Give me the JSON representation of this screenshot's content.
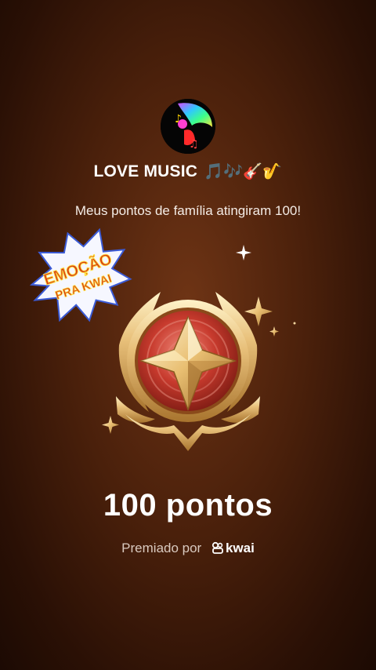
{
  "channel": {
    "name": "LOVE MUSIC",
    "emoji": "🎵🎶🎸🎷"
  },
  "message": "Meus pontos de família atingiram 100!",
  "sticker": {
    "line1": "EMOÇÃO",
    "line2": "PRA KWAI"
  },
  "points_label": "100 pontos",
  "awarded_by": {
    "prefix": "Premiado por",
    "brand": "kwai"
  },
  "colors": {
    "background": "#4a200b",
    "gold": "#e8c07a",
    "badge_red": "#c0392b"
  }
}
